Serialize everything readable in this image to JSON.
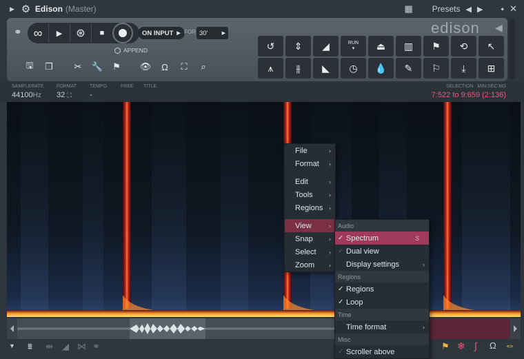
{
  "window": {
    "title": "Edison",
    "subtitle": "(Master)",
    "presets_label": "Presets",
    "icons": [
      "collapse-triangle-icon",
      "gear-icon",
      "grid-icon",
      "arrow-left-icon",
      "arrow-right-icon",
      "pin-icon",
      "close-icon"
    ]
  },
  "logo": "edison",
  "transport": {
    "loop_symbol": "∞",
    "play_symbol": "▶",
    "record_mode_symbol": "⊛",
    "stop_symbol": "■",
    "on_input_label": "ON INPUT",
    "for_label": "FOR",
    "for_value": "30'",
    "append_label": "APPEND"
  },
  "info": {
    "samplerate_label": "SAMPLERATE",
    "samplerate_value": "44100",
    "samplerate_unit": "Hz",
    "format_label": "FORMAT",
    "format_value": "32",
    "tempo_label": "TEMPO",
    "tempo_value": "-",
    "free_label": "FREE",
    "title_label": "TITLE",
    "selection_label": "SELECTION",
    "time_format_label": "MIN:SEC:MS",
    "selection_value": "7:522 to 9:659 (2:136)"
  },
  "main_menu": {
    "items": [
      {
        "label": "File"
      },
      {
        "label": "Format"
      },
      {
        "label": "Edit"
      },
      {
        "label": "Tools"
      },
      {
        "label": "Regions"
      },
      {
        "label": "View"
      },
      {
        "label": "Snap"
      },
      {
        "label": "Select"
      },
      {
        "label": "Zoom"
      }
    ]
  },
  "view_submenu": {
    "audio_header": "Audio",
    "spectrum": "Spectrum",
    "spectrum_shortcut": "S",
    "dual_view": "Dual view",
    "display_settings": "Display settings",
    "regions_header": "Regions",
    "regions": "Regions",
    "loop": "Loop",
    "time_header": "Time",
    "time_format": "Time format",
    "misc_header": "Misc",
    "scroller_above": "Scroller above"
  },
  "colors": {
    "accent": "#e8577a",
    "menu_active": "#a03a5a",
    "panel": "#525b62"
  }
}
